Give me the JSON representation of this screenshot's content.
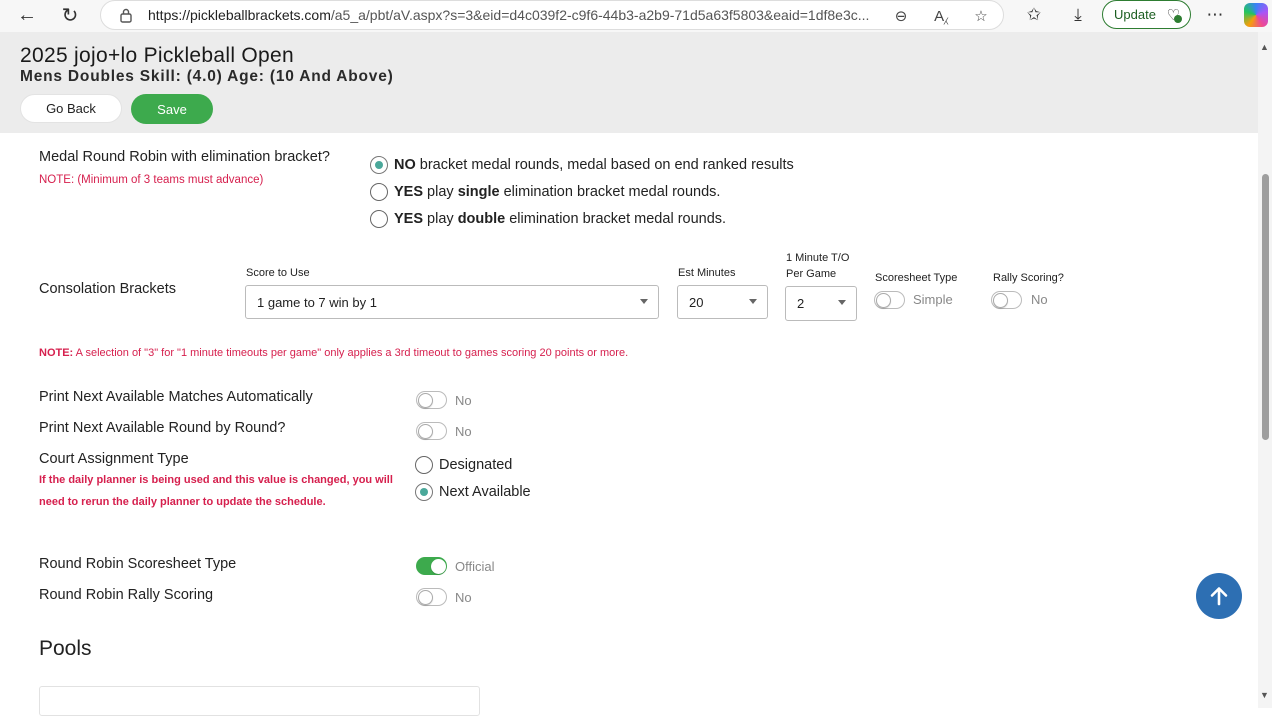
{
  "browser": {
    "url_host": "https://pickleballbrackets.com",
    "url_path": "/a5_a/pbt/aV.aspx?s=3&eid=d4c039f2-c9f6-44b3-a2b9-71d5a63f5803&eaid=1df8e3c...",
    "update_label": "Update"
  },
  "header": {
    "title": "2025 jojo+lo Pickleball Open",
    "subtitle": "Mens Doubles Skill: (4.0) Age: (10 And Above)",
    "go_back_label": "Go Back",
    "save_label": "Save"
  },
  "medal": {
    "label": "Medal Round Robin with elimination bracket?",
    "note": "NOTE: (Minimum of 3 teams must advance)",
    "options": [
      {
        "pre": "NO",
        "mid": " bracket medal rounds, medal based on end ranked results",
        "bold2": "",
        "post": "",
        "checked": true
      },
      {
        "pre": "YES",
        "mid": " play ",
        "bold2": "single",
        "post": " elimination bracket medal rounds.",
        "checked": false
      },
      {
        "pre": "YES",
        "mid": " play ",
        "bold2": "double",
        "post": " elimination bracket medal rounds.",
        "checked": false
      }
    ]
  },
  "consolation": {
    "label": "Consolation Brackets",
    "score_label": "Score to Use",
    "score_value": "1 game to 7 win by 1",
    "est_label": "Est Minutes",
    "est_value": "20",
    "timeout_label_1": "1 Minute T/O",
    "timeout_label_2": "Per Game",
    "timeout_value": "2",
    "scoresheet_label": "Scoresheet Type",
    "scoresheet_value": "Simple",
    "rally_label": "Rally Scoring?",
    "rally_value": "No",
    "note_prefix": "NOTE:",
    "note_text": " A selection of \"3\" for \"1 minute timeouts per game\" only applies a 3rd timeout to games scoring 20 points or more."
  },
  "print_next_matches": {
    "label": "Print Next Available Matches Automatically",
    "value": "No",
    "on": false
  },
  "print_next_round": {
    "label": "Print Next Available Round by Round?",
    "value": "No",
    "on": false
  },
  "court_assignment": {
    "label": "Court Assignment Type",
    "note_line1": "If the daily planner is being used and this value is changed, you will",
    "note_line2": "need to rerun the daily planner to update the schedule.",
    "options": [
      {
        "label": "Designated",
        "checked": false
      },
      {
        "label": "Next Available",
        "checked": true
      }
    ]
  },
  "rr_scoresheet": {
    "label": "Round Robin Scoresheet Type",
    "value": "Official",
    "on": true
  },
  "rr_rally": {
    "label": "Round Robin Rally Scoring",
    "value": "No",
    "on": false
  },
  "pools": {
    "heading": "Pools"
  },
  "colors": {
    "save_green": "#3daa4d",
    "note_red": "#d6204e",
    "fab_blue": "#2d6fb3",
    "radio_teal": "#4aa89a"
  }
}
